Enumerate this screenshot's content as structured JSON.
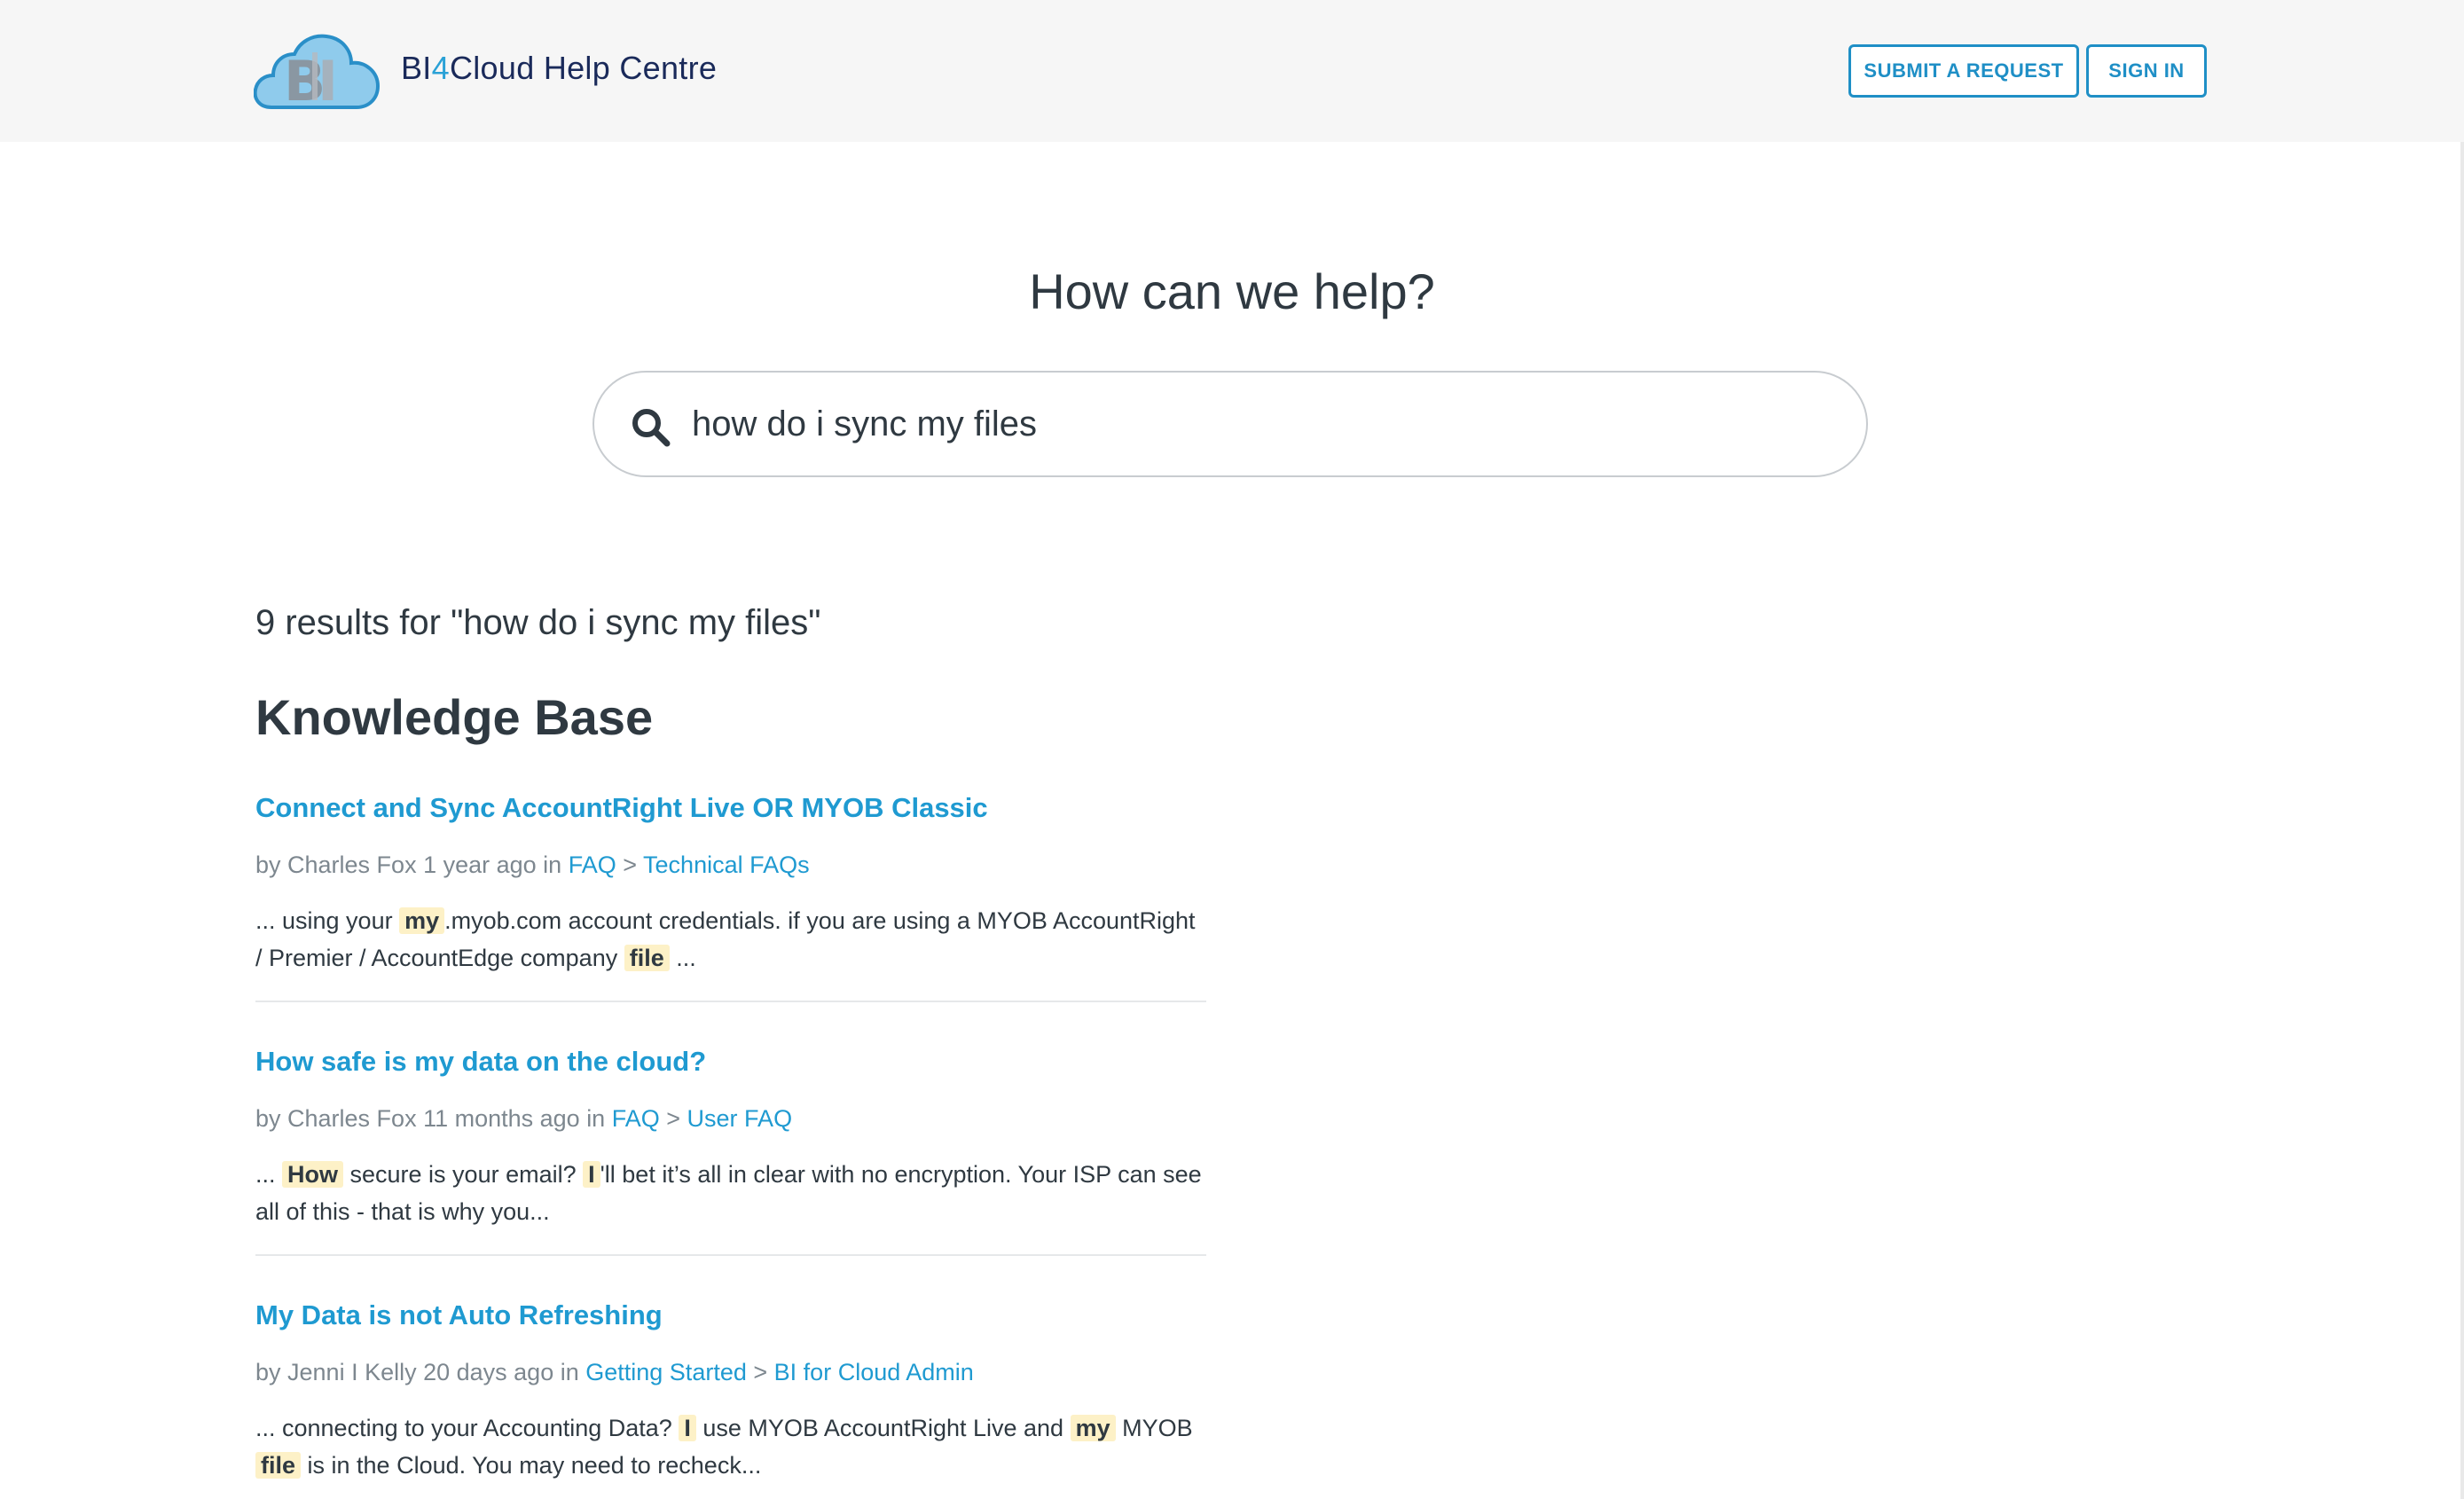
{
  "header": {
    "brand_prefix": "BI",
    "brand_four": "4",
    "brand_suffix": "Cloud Help Centre",
    "submit_label": "SUBMIT A REQUEST",
    "signin_label": "SIGN IN",
    "logo_icon": "cloud-logo-icon"
  },
  "hero": {
    "title": "How can we help?",
    "search_value": "how do i sync my files",
    "search_icon": "search-icon"
  },
  "results": {
    "count_text": "9 results for \"how do i sync my files\"",
    "section_title": "Knowledge Base",
    "items": [
      {
        "title": "Connect and Sync AccountRight Live OR MYOB Classic",
        "meta_prefix": "by Charles Fox 1 year ago in",
        "category": "FAQ",
        "separator": ">",
        "section": "Technical FAQs",
        "snippet": [
          {
            "t": "... using your "
          },
          {
            "t": "my",
            "hl": true
          },
          {
            "t": ".myob.com account credentials. if you are using a MYOB AccountRight / Premier / AccountEdge company "
          },
          {
            "t": "file",
            "hl": true
          },
          {
            "t": " ..."
          }
        ]
      },
      {
        "title": "How safe is my data on the cloud?",
        "meta_prefix": "by Charles Fox 11 months ago in",
        "category": "FAQ",
        "separator": ">",
        "section": "User FAQ",
        "snippet": [
          {
            "t": "...   "
          },
          {
            "t": "How",
            "hl": true
          },
          {
            "t": " secure is your email? "
          },
          {
            "t": "I",
            "hl": true
          },
          {
            "t": "'ll bet it’s all in clear with no encryption. Your ISP can see all of this - that is why you..."
          }
        ]
      },
      {
        "title": "My Data is not Auto Refreshing",
        "meta_prefix": "by Jenni I Kelly 20 days ago in",
        "category": "Getting Started",
        "separator": ">",
        "section": "BI for Cloud Admin",
        "snippet": [
          {
            "t": "... connecting to your Accounting Data? "
          },
          {
            "t": "I",
            "hl": true
          },
          {
            "t": " use MYOB AccountRight Live and "
          },
          {
            "t": "my",
            "hl": true
          },
          {
            "t": " MYOB "
          },
          {
            "t": "file",
            "hl": true
          },
          {
            "t": " is in the Cloud. You may need to recheck..."
          }
        ]
      }
    ]
  }
}
